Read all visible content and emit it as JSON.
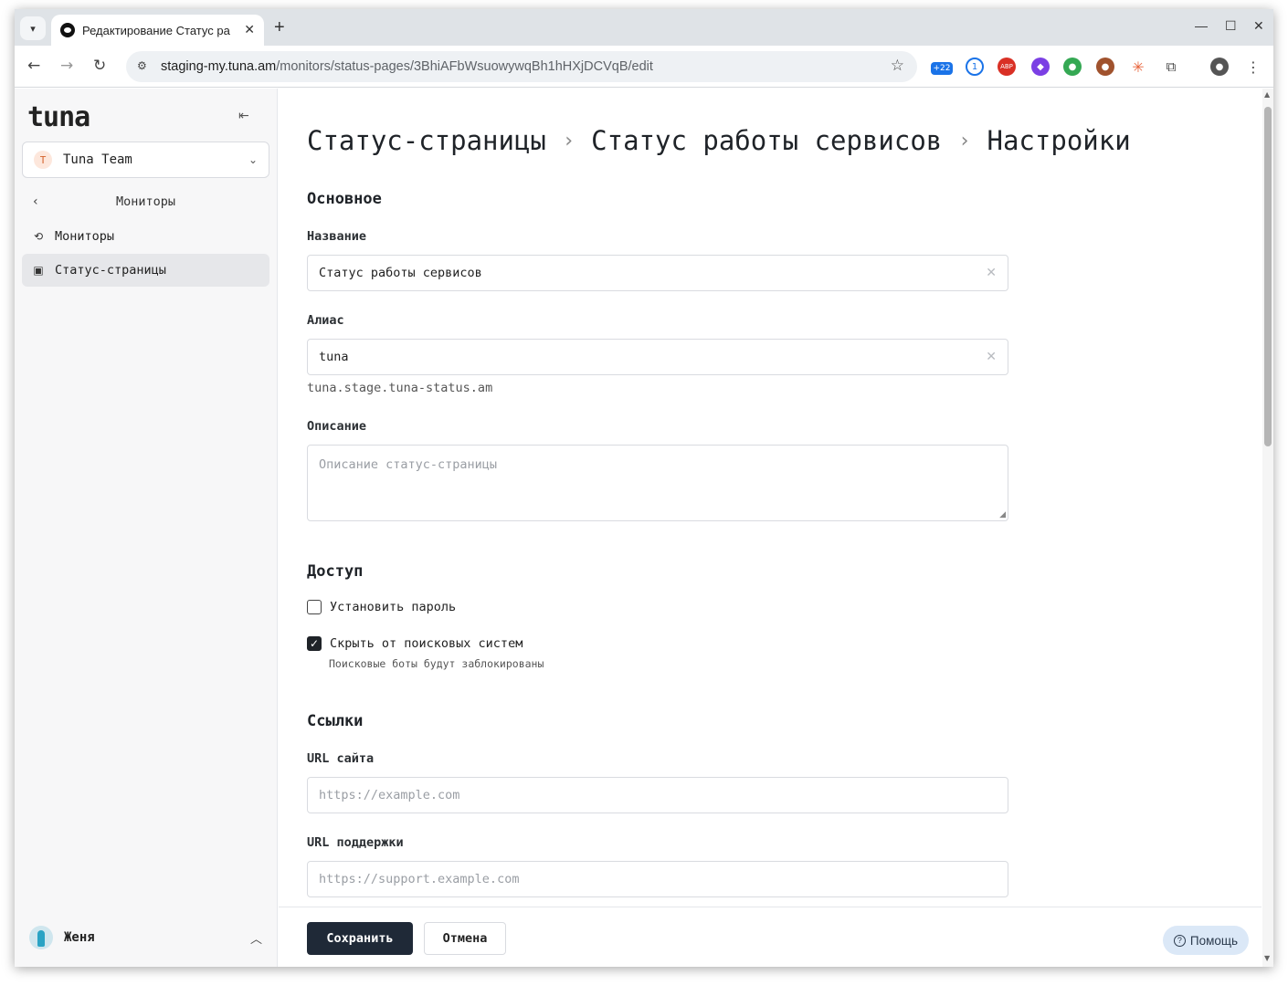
{
  "browser": {
    "tab_title": "Редактирование Статус ра",
    "tab_close": "✕",
    "new_tab": "+",
    "url_host": "staging-my.tuna.am",
    "url_path": "/monitors/status-pages/3BhiAFbWsuowywqBh1hHXjDCVqB/edit",
    "extension_badge": "+22"
  },
  "sidebar": {
    "logo": "tuna",
    "team": {
      "initial": "T",
      "name": "Tuna Team"
    },
    "back_label": "Мониторы",
    "items": [
      {
        "label": "Мониторы",
        "icon": "history-icon",
        "active": false
      },
      {
        "label": "Статус-страницы",
        "icon": "chart-icon",
        "active": true
      }
    ],
    "user": {
      "name": "Женя"
    }
  },
  "main": {
    "breadcrumb": [
      "Статус-страницы",
      "Статус работы сервисов",
      "Настройки"
    ],
    "sections": {
      "basic": "Основное",
      "access": "Доступ",
      "links": "Ссылки"
    },
    "fields": {
      "name": {
        "label": "Название",
        "value": "Статус работы сервисов"
      },
      "alias": {
        "label": "Алиас",
        "value": "tuna",
        "hint": "tuna.stage.tuna-status.am"
      },
      "description": {
        "label": "Описание",
        "placeholder": "Описание статус-страницы"
      },
      "site_url": {
        "label": "URL сайта",
        "placeholder": "https://example.com"
      },
      "support_url": {
        "label": "URL поддержки",
        "placeholder": "https://support.example.com"
      }
    },
    "access": {
      "set_password": {
        "label": "Установить пароль",
        "checked": false
      },
      "hide_from_search": {
        "label": "Скрыть от поисковых систем",
        "checked": true,
        "hint": "Поисковые боты будут заблокированы"
      }
    }
  },
  "footer": {
    "save": "Сохранить",
    "cancel": "Отмена",
    "help": "Помощь"
  }
}
